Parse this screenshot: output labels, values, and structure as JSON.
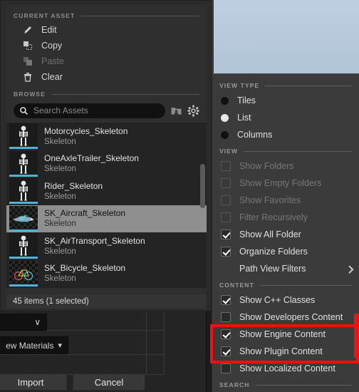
{
  "picker": {
    "current_asset": {
      "header": "CURRENT ASSET",
      "items": [
        {
          "label": "Edit",
          "icon": "pencil-icon",
          "disabled": false
        },
        {
          "label": "Copy",
          "icon": "copy-icon",
          "disabled": false
        },
        {
          "label": "Paste",
          "icon": "paste-icon",
          "disabled": true
        },
        {
          "label": "Clear",
          "icon": "trash-icon",
          "disabled": false
        }
      ]
    },
    "browse": {
      "header": "BROWSE",
      "search_placeholder": "Search Assets",
      "search_value": "",
      "search_icon": "search-icon",
      "sources_icon": "sources-folder-icon",
      "settings_icon": "gear-icon"
    },
    "assets": [
      {
        "name": "Motorcycles_Skeleton",
        "type": "Skeleton",
        "thumb": "skeleton-figure",
        "selected": false
      },
      {
        "name": "OneAxleTrailer_Skeleton",
        "type": "Skeleton",
        "thumb": "skeleton-figure",
        "selected": false
      },
      {
        "name": "Rider_Skeleton",
        "type": "Skeleton",
        "thumb": "skeleton-figure",
        "selected": false
      },
      {
        "name": "SK_Aircraft_Skeleton",
        "type": "Skeleton",
        "thumb": "aircraft-mesh",
        "selected": true
      },
      {
        "name": "SK_AirTransport_Skeleton",
        "type": "Skeleton",
        "thumb": "skeleton-figure",
        "selected": false
      },
      {
        "name": "SK_Bicycle_Skeleton",
        "type": "Skeleton",
        "thumb": "bicycle-mesh",
        "selected": false
      }
    ],
    "status": "45 items (1 selected)"
  },
  "background_dialog": {
    "combo_top": "∨",
    "combo_materials": "ew Materials",
    "import_label": "Import",
    "cancel_label": "Cancel"
  },
  "context_menu": {
    "view_type": {
      "header": "VIEW TYPE",
      "options": [
        {
          "label": "Tiles",
          "selected": false
        },
        {
          "label": "List",
          "selected": true
        },
        {
          "label": "Columns",
          "selected": false
        }
      ]
    },
    "view": {
      "header": "VIEW",
      "items": [
        {
          "label": "Show Folders",
          "checked": false,
          "disabled": true,
          "submenu": false
        },
        {
          "label": "Show Empty Folders",
          "checked": false,
          "disabled": true,
          "submenu": false
        },
        {
          "label": "Show Favorites",
          "checked": false,
          "disabled": true,
          "submenu": false
        },
        {
          "label": "Filter Recursively",
          "checked": false,
          "disabled": true,
          "submenu": false
        },
        {
          "label": "Show All Folder",
          "checked": true,
          "disabled": false,
          "submenu": false
        },
        {
          "label": "Organize Folders",
          "checked": true,
          "disabled": false,
          "submenu": false
        },
        {
          "label": "Path View Filters",
          "checked": null,
          "disabled": false,
          "submenu": true
        }
      ]
    },
    "content": {
      "header": "CONTENT",
      "items": [
        {
          "label": "Show C++ Classes",
          "checked": true,
          "highlighted": false
        },
        {
          "label": "Show Developers Content",
          "checked": false,
          "highlighted": false
        },
        {
          "label": "Show Engine Content",
          "checked": true,
          "highlighted": true
        },
        {
          "label": "Show Plugin Content",
          "checked": true,
          "highlighted": true
        },
        {
          "label": "Show Localized Content",
          "checked": false,
          "highlighted": false
        }
      ]
    },
    "search": {
      "header": "SEARCH"
    }
  },
  "annotation": {
    "color": "#ff0d0d"
  }
}
